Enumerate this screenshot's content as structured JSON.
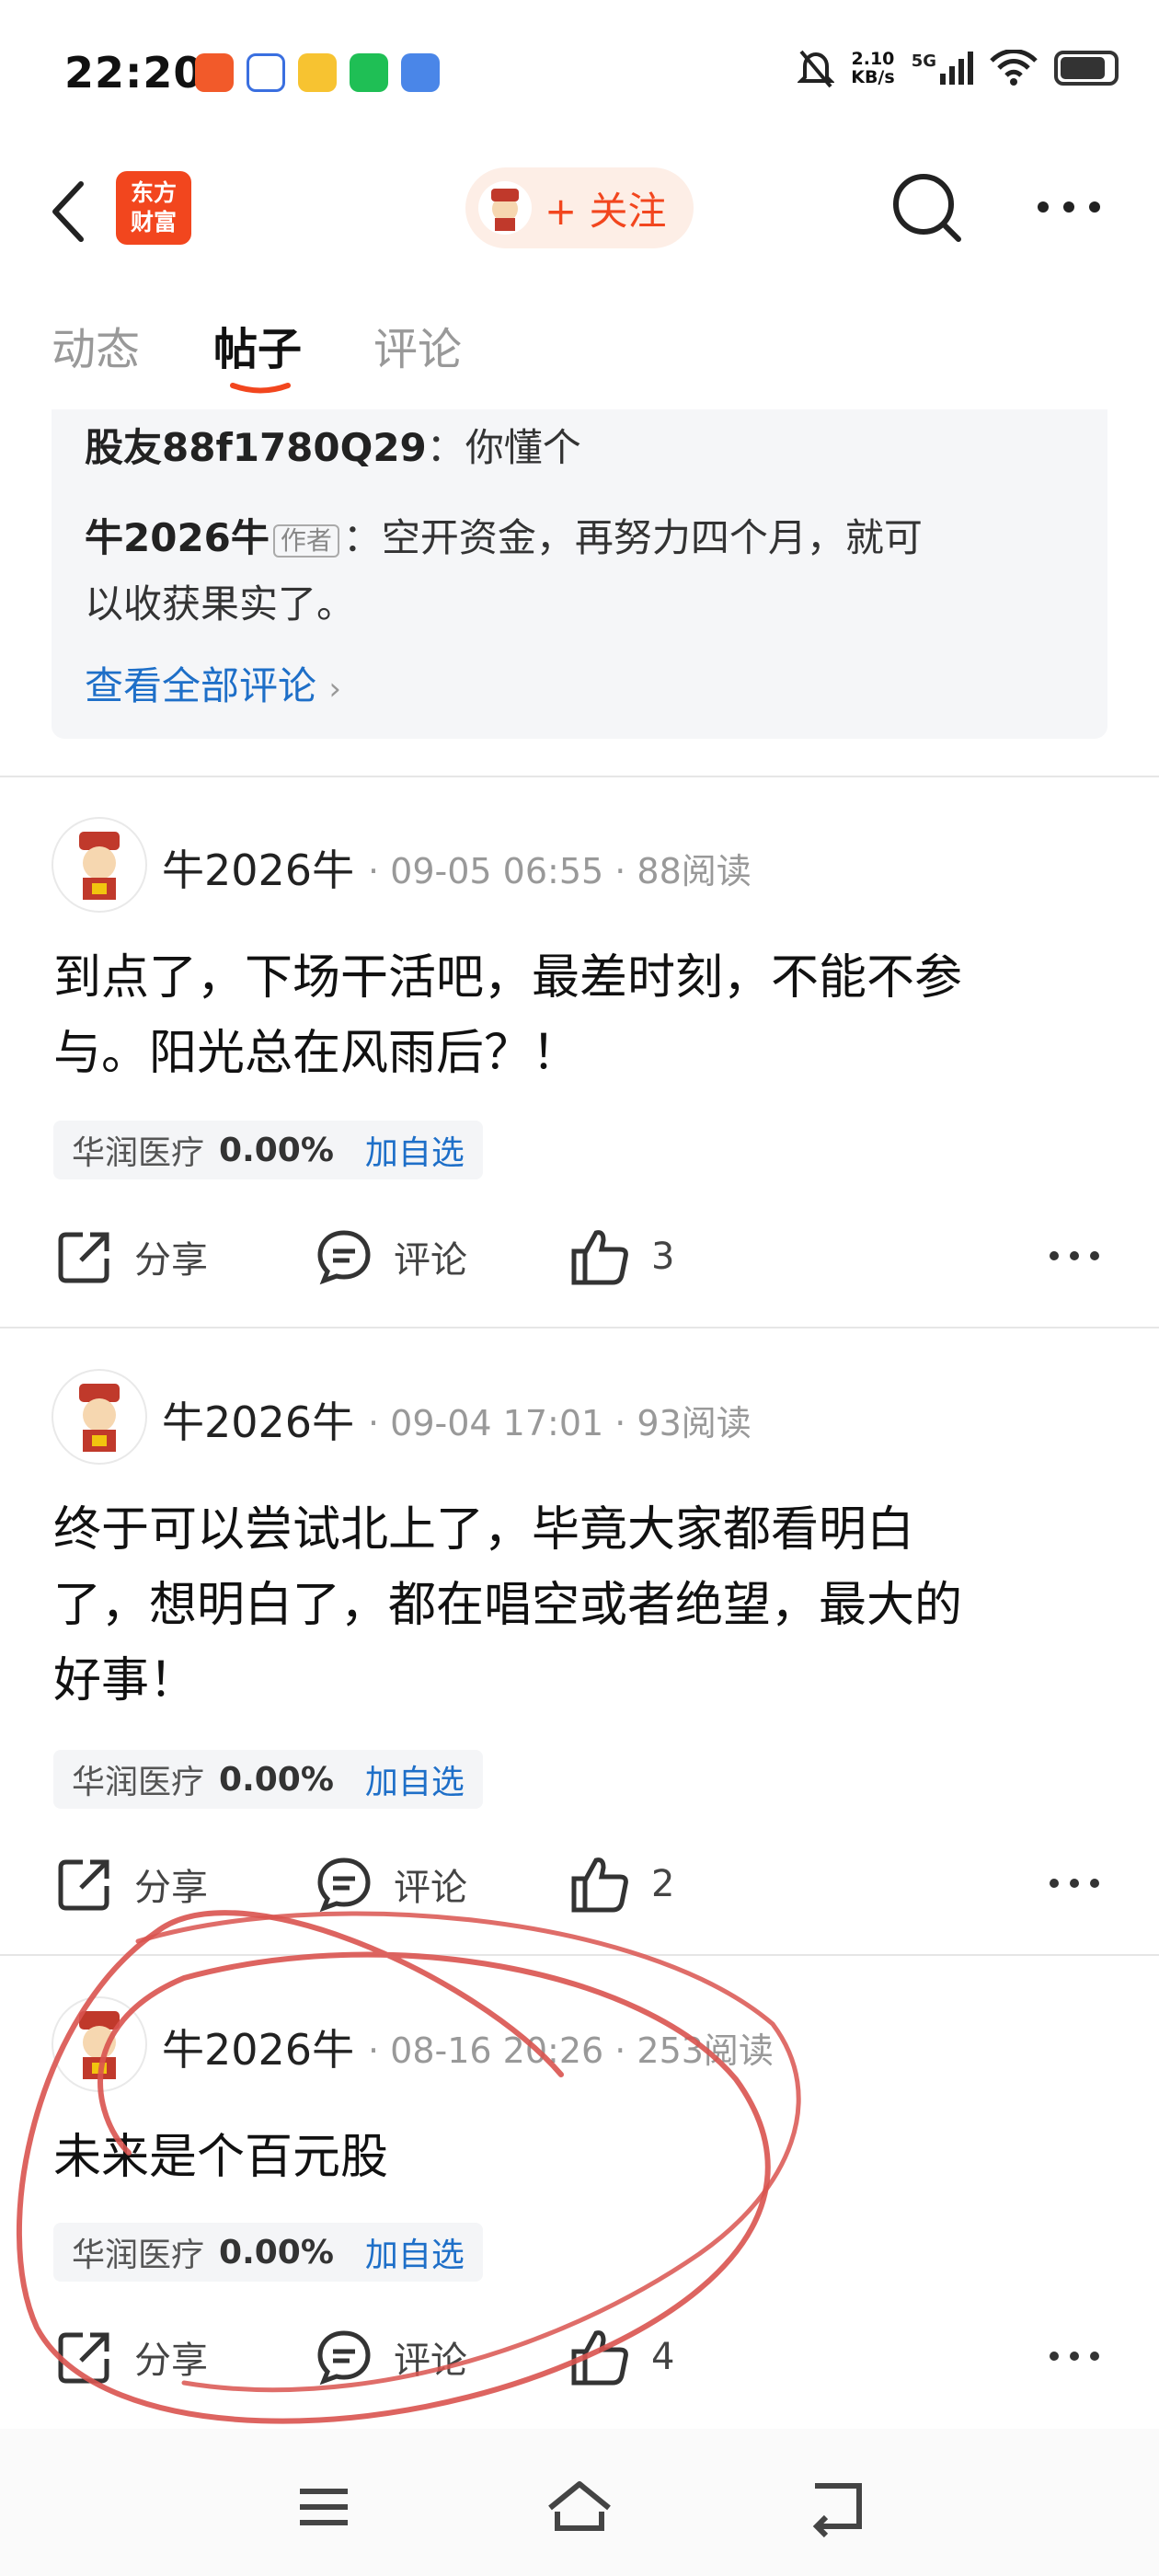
{
  "status_bar": {
    "time": "22:20",
    "net_speed_top": "2.10",
    "net_speed_bottom": "KB/s",
    "network": "5G",
    "notification_icons": [
      "app-icon",
      "baidu-icon",
      "weibo-icon",
      "wechat-icon",
      "chart-app-icon"
    ]
  },
  "header": {
    "logo_line1": "东方",
    "logo_line2": "财富",
    "follow_label": "+ 关注"
  },
  "tabs": [
    {
      "label": "动态"
    },
    {
      "label": "帖子"
    },
    {
      "label": "评论"
    }
  ],
  "comments_preview": {
    "line1_user": "股友88f1780Q29",
    "line1_sep": "：",
    "line1_text": "你懂个",
    "line2_user": "牛2026牛",
    "line2_tag": "作者",
    "line2_text_a": "：空开资金，再努力四个月，就可",
    "line2_text_b": "以收获果实了。",
    "view_all": "查看全部评论"
  },
  "posts": [
    {
      "author": "牛2026牛",
      "meta": "· 09-05 06:55 · 88阅读",
      "body_line1": "到点了，下场干活吧，最差时刻，不能不参",
      "body_line2": "与。阳光总在风雨后？！",
      "stock_name": "华润医疗",
      "stock_pct": "0.00%",
      "stock_add": "加自选",
      "share": "分享",
      "comment": "评论",
      "likes": "3"
    },
    {
      "author": "牛2026牛",
      "meta": "· 09-04 17:01 · 93阅读",
      "body_line1": "终于可以尝试北上了，毕竟大家都看明白",
      "body_line2": "了，想明白了，都在唱空或者绝望，最大的",
      "body_line3": "好事！",
      "stock_name": "华润医疗",
      "stock_pct": "0.00%",
      "stock_add": "加自选",
      "share": "分享",
      "comment": "评论",
      "likes": "2"
    },
    {
      "author": "牛2026牛",
      "meta": "· 08-16 20:26 · 253阅读",
      "body_line1": "未来是个百元股",
      "stock_name": "华润医疗",
      "stock_pct": "0.00%",
      "stock_add": "加自选",
      "share": "分享",
      "comment": "评论",
      "likes": "4"
    }
  ],
  "colors": {
    "brand": "#f2461e",
    "link": "#1e6fc8",
    "annotation": "#d9534f"
  }
}
